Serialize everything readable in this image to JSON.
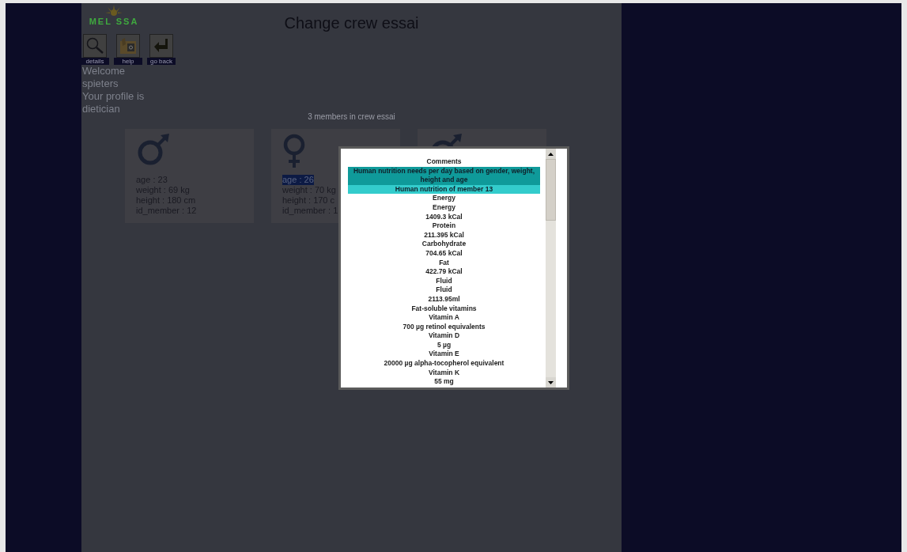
{
  "logo": {
    "text": "MEL SSA"
  },
  "toolbar": [
    {
      "label": "details",
      "kind": "search"
    },
    {
      "label": "help",
      "kind": "help"
    },
    {
      "label": "go back",
      "kind": "back"
    }
  ],
  "welcome": [
    "Welcome",
    "spieters",
    "Your profile is",
    "dietician"
  ],
  "title": "Change crew essai",
  "members_summary": "3 members in crew essai",
  "members": [
    {
      "kind": "male",
      "lines": [
        {
          "text": "age : 23",
          "highlighted": false
        },
        {
          "text": "weight : 69 kg",
          "highlighted": false
        },
        {
          "text": "height : 180 cm",
          "highlighted": false
        },
        {
          "text": "id_member : 12",
          "highlighted": false
        }
      ]
    },
    {
      "kind": "female",
      "lines": [
        {
          "text": "age : 26",
          "highlighted": true
        },
        {
          "text": "weight : 70 kg",
          "highlighted": false
        },
        {
          "text": "height : 170 c",
          "highlighted": false
        },
        {
          "text": "id_member : 1",
          "highlighted": false
        }
      ]
    },
    {
      "kind": "male",
      "partial": true
    }
  ],
  "dialog": {
    "rows": [
      {
        "kind": "header",
        "text": "Comments"
      },
      {
        "kind": "title",
        "text": "Human nutrition needs per day based on gender, weight, height and age"
      },
      {
        "kind": "subtitle",
        "text": "Human nutrition of member 13"
      },
      {
        "kind": "item",
        "text": "Energy"
      },
      {
        "kind": "item",
        "text": "Energy"
      },
      {
        "kind": "item",
        "text": "1409.3 kCal"
      },
      {
        "kind": "item",
        "text": "Protein"
      },
      {
        "kind": "item",
        "text": "211.395 kCal"
      },
      {
        "kind": "item",
        "text": "Carbohydrate"
      },
      {
        "kind": "item",
        "text": "704.65 kCal"
      },
      {
        "kind": "item",
        "text": "Fat"
      },
      {
        "kind": "item",
        "text": "422.79 kCal"
      },
      {
        "kind": "item",
        "text": "Fluid"
      },
      {
        "kind": "item",
        "text": "Fluid"
      },
      {
        "kind": "item",
        "text": "2113.95ml"
      },
      {
        "kind": "item",
        "text": "Fat-soluble vitamins"
      },
      {
        "kind": "item",
        "text": "Vitamin A"
      },
      {
        "kind": "item",
        "text": "700 µg retinol equivalents"
      },
      {
        "kind": "item",
        "text": "Vitamin D"
      },
      {
        "kind": "item",
        "text": "5 µg"
      },
      {
        "kind": "item",
        "text": "Vitamin E"
      },
      {
        "kind": "item",
        "text": "20000 µg alpha-tocopherol equivalent"
      },
      {
        "kind": "item",
        "text": "Vitamin K"
      },
      {
        "kind": "item",
        "text": "55 mg"
      }
    ]
  }
}
